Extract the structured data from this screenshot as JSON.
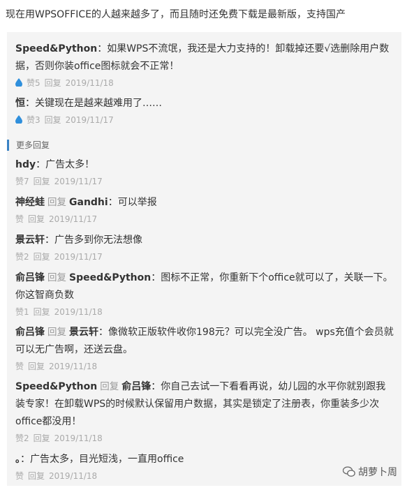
{
  "intro": "现在用WPSOFFICE的人越来越多了，而且随时还免费下载是最新版，支持国产",
  "more_label": "更多回复",
  "reply_word": "回复",
  "comments": [
    {
      "author": "Speed&Python",
      "text": "：如果WPS不流氓，我还是大力支持的！卸载掉还要√选删除用户数据，否则你装office图标就会不正常！",
      "likes": "赞5",
      "reply": "回复",
      "date": "2019/11/18"
    },
    {
      "author": "恒",
      "text": "：关键现在是越来越难用了……",
      "likes": "赞3",
      "reply": "回复",
      "date": "2019/11/17"
    },
    {
      "author": "hdy",
      "text": "：广告太多！",
      "likes": "赞7",
      "reply": "回复",
      "date": "2019/11/17"
    },
    {
      "author": "神经蛙",
      "to": "Gandhi",
      "text": "：可以举报",
      "likes": "赞",
      "reply": "回复",
      "date": "2019/11/17"
    },
    {
      "author": "景云轩",
      "text": "：广告多到你无法想像",
      "likes": "赞2",
      "reply": "回复",
      "date": "2019/11/17"
    },
    {
      "author": "俞吕锋",
      "to": "Speed&Python",
      "text": "：图标不正常，你重新下个office就可以了，关联一下。你这智商负数",
      "likes": "赞1",
      "reply": "回复",
      "date": "2019/11/18"
    },
    {
      "author": "俞吕锋",
      "to": "景云轩",
      "text": "：像微软正版软件收你198元？可以完全没广告。 wps充值个会员就可以无广告啊，还送云盘。",
      "likes": "赞",
      "reply": "回复",
      "date": "2019/11/18"
    },
    {
      "author": "Speed&Python",
      "to": "俞吕锋",
      "text": "：你自己去试一下看看再说，幼儿园的水平你就别跟我装专家！在卸载WPS的时候默认保留用户数据，其实是锁定了注册表，你重装多少次office都没用！",
      "likes": "赞2",
      "reply": "回复",
      "date": "2019/11/18"
    },
    {
      "author": "。",
      "text": "：广告太多，目光短浅，一直用office",
      "likes": "赞",
      "reply": "回复",
      "date": "2019/11/18"
    }
  ],
  "watermark": "胡萝卜周",
  "colors": {
    "accent": "#3a82c4",
    "drop": "#2f8fdc",
    "meta": "#aaaaaa"
  }
}
